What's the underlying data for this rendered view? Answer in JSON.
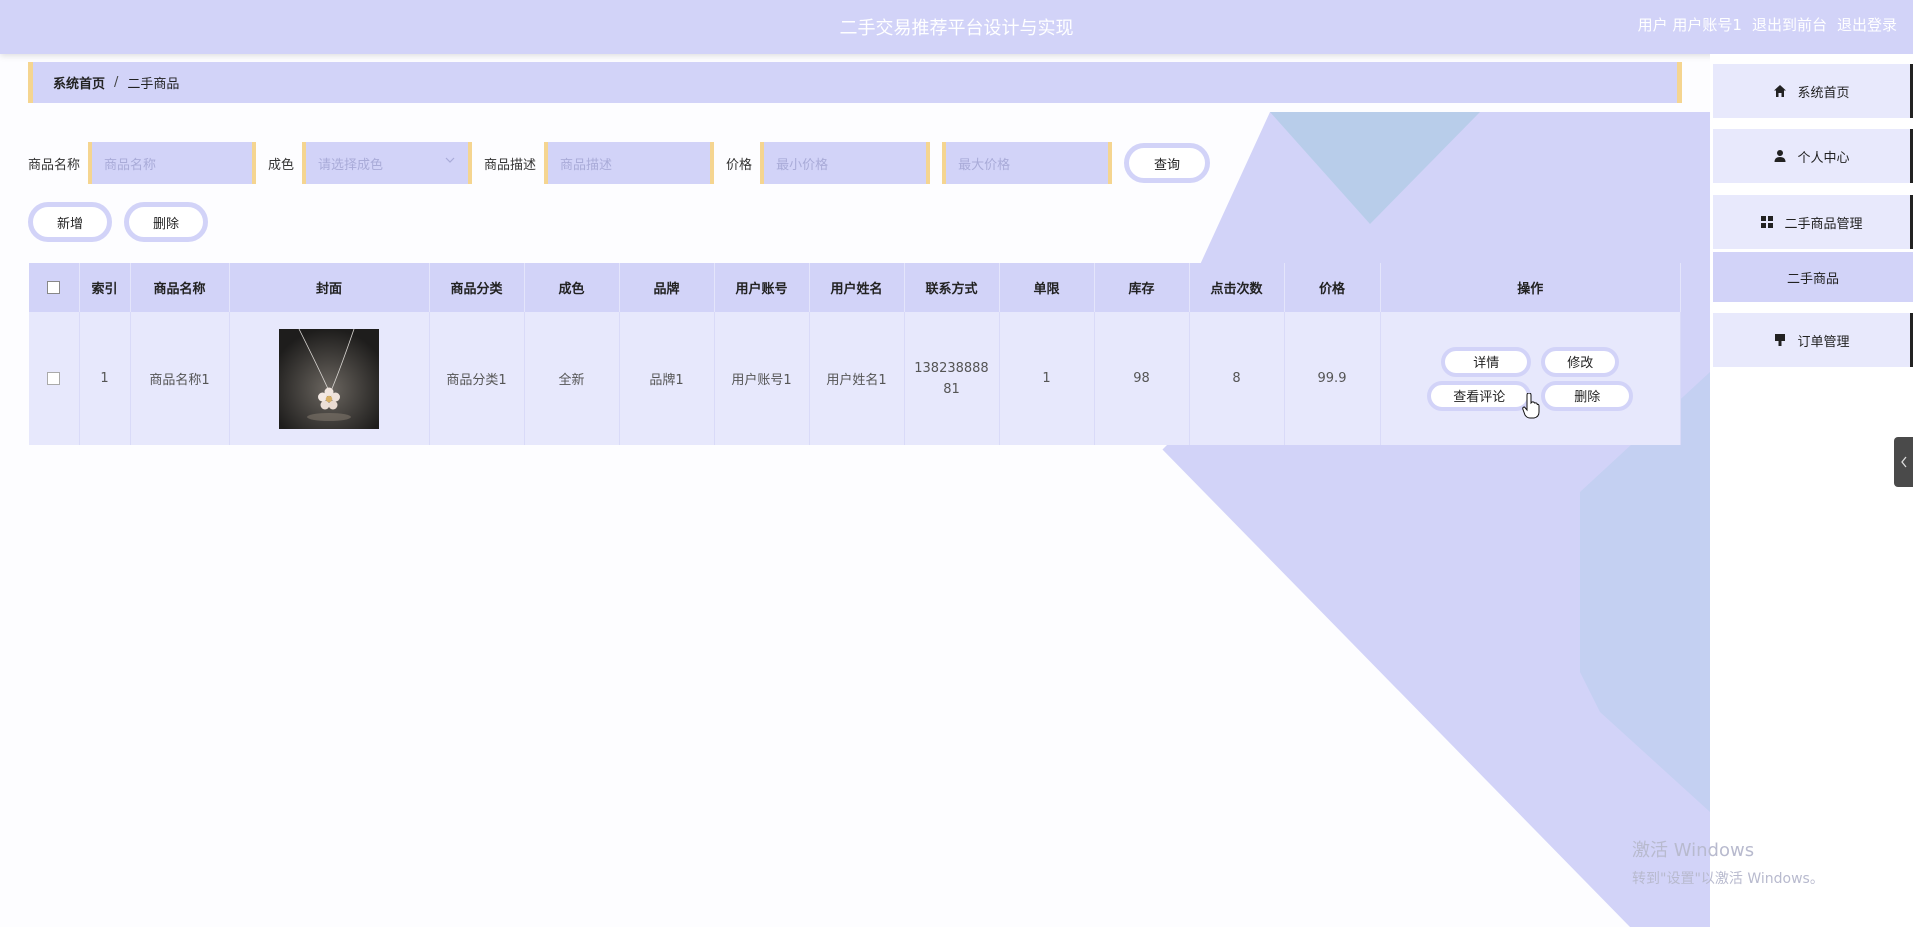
{
  "header": {
    "title": "二手交易推荐平台设计与实现",
    "user_label": "用户 用户账号1",
    "exit_front": "退出到前台",
    "logout": "退出登录"
  },
  "breadcrumb": {
    "home": "系统首页",
    "sep": "/",
    "current": "二手商品"
  },
  "search": {
    "name_label": "商品名称",
    "name_placeholder": "商品名称",
    "color_label": "成色",
    "color_placeholder": "请选择成色",
    "desc_label": "商品描述",
    "desc_placeholder": "商品描述",
    "price_label": "价格",
    "min_placeholder": "最小价格",
    "max_placeholder": "最大价格",
    "query_button": "查询"
  },
  "actions": {
    "add": "新增",
    "delete": "删除"
  },
  "table": {
    "headers": [
      "索引",
      "商品名称",
      "封面",
      "商品分类",
      "成色",
      "品牌",
      "用户账号",
      "用户姓名",
      "联系方式",
      "单限",
      "库存",
      "点击次数",
      "价格",
      "操作"
    ],
    "rows": [
      {
        "index": "1",
        "name": "商品名称1",
        "category": "商品分类1",
        "condition": "全新",
        "brand": "品牌1",
        "account": "用户账号1",
        "username": "用户姓名1",
        "contact_line1": "138238888",
        "contact_line2": "81",
        "limit": "1",
        "stock": "98",
        "clicks": "8",
        "price": "99.9",
        "ops": {
          "detail": "详情",
          "edit": "修改",
          "comments": "查看评论",
          "delete": "删除"
        }
      }
    ]
  },
  "sidebar": {
    "home": "系统首页",
    "profile": "个人中心",
    "goods_mgmt": "二手商品管理",
    "goods": "二手商品",
    "orders": "订单管理"
  },
  "watermark": {
    "line1": "激活 Windows",
    "line2": "转到\"设置\"以激活 Windows。"
  },
  "colors": {
    "primary": "#d2d3f8",
    "accent_border": "#f5d590",
    "row_bg": "#e7e8fc"
  }
}
